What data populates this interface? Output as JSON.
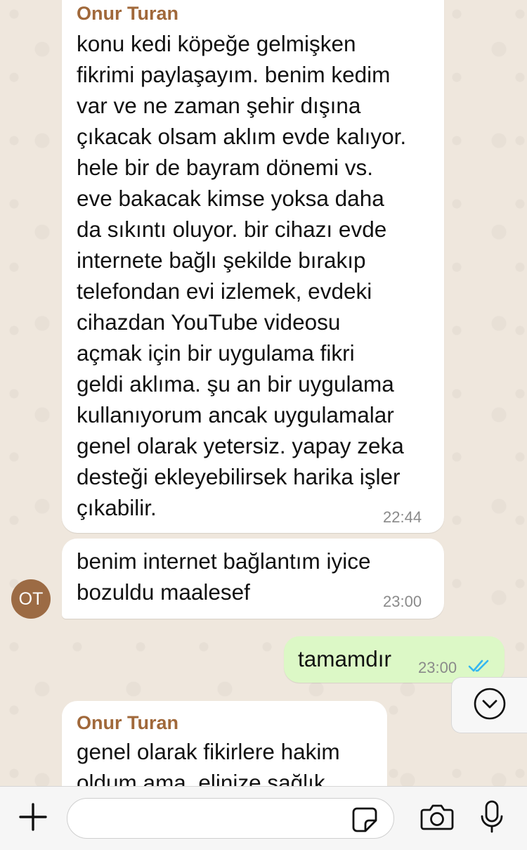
{
  "messages": [
    {
      "sender": "Onur Turan",
      "text": "konu kedi köpeğe gelmişken\nfikrimi paylaşayım. benim kedim\nvar ve ne zaman şehir dışına\nçıkacak olsam aklım evde kalıyor.\nhele bir de bayram dönemi vs.\neve bakacak kimse yoksa daha\nda sıkıntı oluyor. bir cihazı evde\ninternete bağlı şekilde bırakıp\ntelefondan evi izlemek, evdeki\ncihazdan YouTube videosu\naçmak için bir uygulama fikri\ngeldi aklıma. şu an bir uygulama\nkullanıyorum ancak uygulamalar\ngenel olarak yetersiz. yapay zeka\ndesteği ekleyebilirsek harika işler\nçıkabilir.",
      "time": "22:44"
    },
    {
      "text": "benim internet bağlantım iyice\nbozuldu maalesef",
      "time": "23:00",
      "avatar_initials": "OT"
    },
    {
      "text": "tamamdır",
      "time": "23:00",
      "status_icon": "double-check-read-icon",
      "status_color": "#34b7f1"
    },
    {
      "sender": "Onur Turan",
      "text": "genel olarak fikirlere hakim\noldum ama, elinize sağlık"
    }
  ],
  "input": {
    "placeholder": "",
    "value": ""
  },
  "colors": {
    "background": "#efe7dd",
    "incoming_bubble": "#ffffff",
    "outgoing_bubble": "#dcf8c6",
    "sender_name": "#a0683a",
    "avatar": "#9c6b44"
  },
  "icons": [
    "plus-icon",
    "sticker-icon",
    "camera-icon",
    "microphone-icon",
    "chevron-down-icon"
  ]
}
